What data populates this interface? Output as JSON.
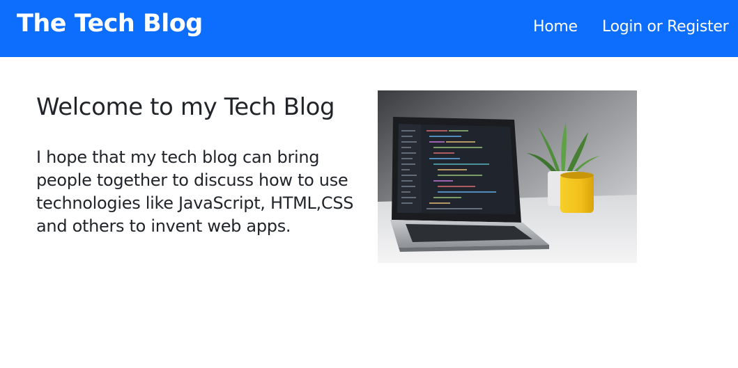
{
  "navbar": {
    "brand": "The Tech Blog",
    "links": [
      {
        "label": "Home"
      },
      {
        "label": "Login or Register"
      }
    ],
    "background": "#0d6efd"
  },
  "main": {
    "heading": "Welcome to my Tech Blog",
    "intro": "I hope that my tech blog can bring people together to discuss how to use technologies like JavaScript, HTML,CSS and others to invent web apps."
  }
}
